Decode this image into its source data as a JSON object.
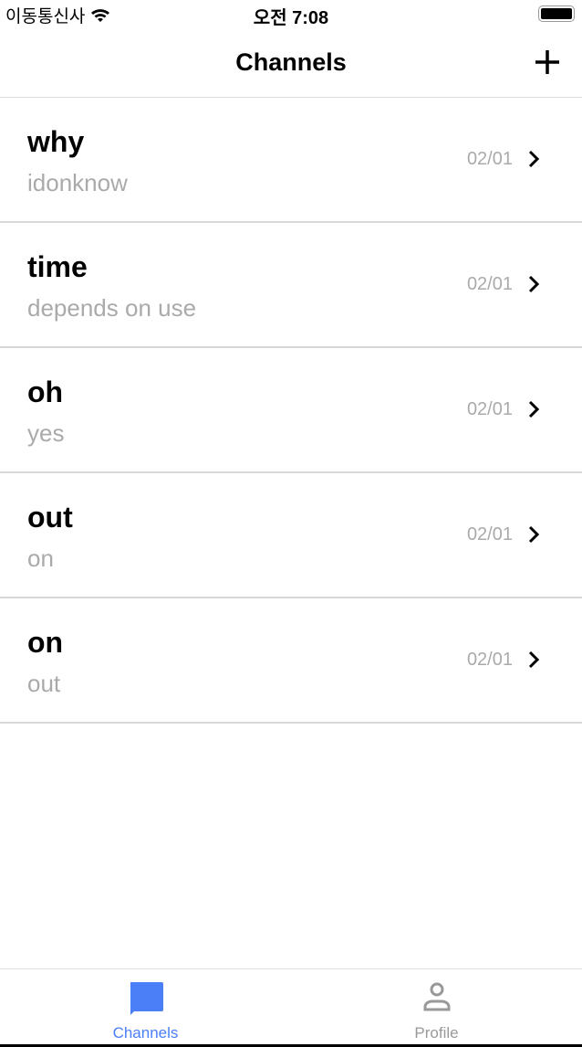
{
  "status": {
    "carrier": "이동통신사",
    "time": "오전 7:08"
  },
  "nav": {
    "title": "Channels"
  },
  "channels": [
    {
      "name": "why",
      "last": "idonknow",
      "date": "02/01"
    },
    {
      "name": "time",
      "last": "depends on use",
      "date": "02/01"
    },
    {
      "name": "oh",
      "last": "yes",
      "date": "02/01"
    },
    {
      "name": "out",
      "last": "on",
      "date": "02/01"
    },
    {
      "name": "on",
      "last": "out",
      "date": "02/01"
    }
  ],
  "tabs": [
    {
      "label": "Channels",
      "active": true
    },
    {
      "label": "Profile",
      "active": false
    }
  ],
  "colors": {
    "accent": "#4a7ff7",
    "inactive": "#999999"
  }
}
